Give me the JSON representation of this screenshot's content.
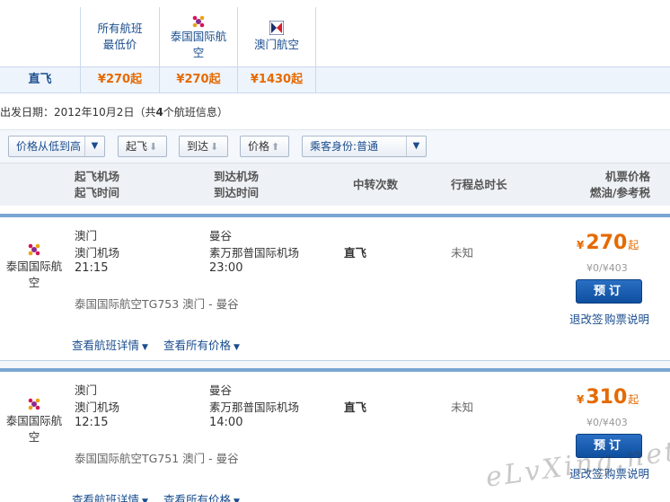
{
  "matrix": {
    "headers": [
      {
        "label": "所有航班\n最低价",
        "line1": "所有航班",
        "line2": "最低价"
      },
      {
        "label": "泰国国际航空",
        "line1": "泰国国际航",
        "line2": "空"
      },
      {
        "label": "澳门航空",
        "line1": "澳门航空",
        "line2": ""
      }
    ],
    "row_label": "直飞",
    "prices": [
      "¥270起",
      "¥270起",
      "¥1430起"
    ]
  },
  "date_line": {
    "prefix": "出发日期：2012年10月2日（共",
    "count": "4",
    "suffix": "个航班信息）"
  },
  "sortbar": {
    "price_sort": "价格从低到高",
    "depart": "起飞",
    "arrive": "到达",
    "price": "价格",
    "passenger": "乘客身份:普通"
  },
  "columns": {
    "dep_airport": "起飞机场",
    "dep_time": "起飞时间",
    "arr_airport": "到达机场",
    "arr_time": "到达时间",
    "transfers": "中转次数",
    "duration": "行程总时长",
    "price": "机票价格",
    "tax": "燃油/参考税"
  },
  "flights": [
    {
      "airline": "泰国国际航空",
      "airline_l1": "泰国国际航",
      "airline_l2": "空",
      "dep_city": "澳门",
      "dep_airport": "澳门机场",
      "dep_time": "21:15",
      "arr_city": "曼谷",
      "arr_airport": "素万那普国际机场",
      "arr_time": "23:00",
      "transfer": "直飞",
      "duration": "未知",
      "price_yen": "¥",
      "price": "270",
      "price_suffix": "起",
      "tax": "¥0/¥403",
      "book": "预订",
      "flight_info": "泰国国际航空TG753  澳门 - 曼谷",
      "rules": "退改签",
      "purchase": "购票说明",
      "details_link": "查看航班详情",
      "all_prices_link": "查看所有价格"
    },
    {
      "airline": "泰国国际航空",
      "airline_l1": "泰国国际航",
      "airline_l2": "空",
      "dep_city": "澳门",
      "dep_airport": "澳门机场",
      "dep_time": "12:15",
      "arr_city": "曼谷",
      "arr_airport": "素万那普国际机场",
      "arr_time": "14:00",
      "transfer": "直飞",
      "duration": "未知",
      "price_yen": "¥",
      "price": "310",
      "price_suffix": "起",
      "tax": "¥0/¥403",
      "book": "预订",
      "flight_info": "泰国国际航空TG751  澳门 - 曼谷",
      "rules": "退改签",
      "purchase": "购票说明",
      "details_link": "查看航班详情",
      "all_prices_link": "查看所有价格"
    }
  ],
  "watermark": "eLvXing.net",
  "colors": {
    "link": "#1a4d8f",
    "price": "#e56a00",
    "book_button": "#1558ad",
    "row_divider": "#7aa6d4"
  },
  "icons": [
    "thai-airways-logo-icon",
    "air-macau-logo-icon",
    "sort-arrow-down-icon",
    "sort-arrow-up-icon",
    "chevron-down-icon"
  ]
}
